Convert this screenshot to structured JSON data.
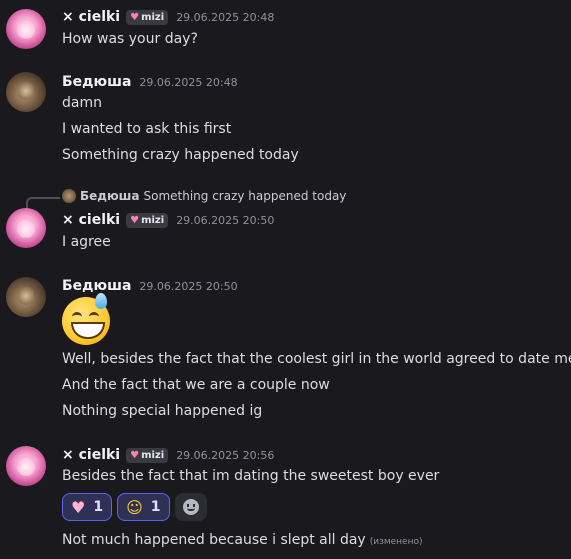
{
  "messages": [
    {
      "author": "× cielki",
      "tag": "mizi",
      "time": "29.06.2025 20:48",
      "lines": [
        "How was your day?"
      ]
    },
    {
      "author": "Бедюша",
      "time": "29.06.2025 20:48",
      "lines": [
        "damn",
        "I wanted to ask this first",
        "Something crazy happened today"
      ]
    },
    {
      "reply": {
        "author": "Бедюша",
        "text": "Something crazy happened today"
      },
      "author": "× cielki",
      "tag": "mizi",
      "time": "29.06.2025 20:50",
      "lines": [
        "I agree"
      ]
    },
    {
      "author": "Бедюша",
      "time": "29.06.2025 20:50",
      "emoji": "grinning-face-with-sweat",
      "lines": [
        "Well, besides the fact that the coolest girl in the world agreed to date me",
        "And the fact that we are a couple now",
        "Nothing special happened ig"
      ]
    },
    {
      "author": "× cielki",
      "tag": "mizi",
      "time": "29.06.2025 20:56",
      "lines": [
        "Besides the fact that im dating the sweetest boy ever",
        "Not much happened because i slept all day"
      ],
      "edited": "(изменено)",
      "reactions": [
        {
          "emoji": "pink-heart",
          "count": "1"
        },
        {
          "emoji": "face-blowing-kiss",
          "count": "1"
        }
      ]
    }
  ],
  "colors": {
    "background": "#1a1a1e",
    "accent": "#5865f2"
  }
}
